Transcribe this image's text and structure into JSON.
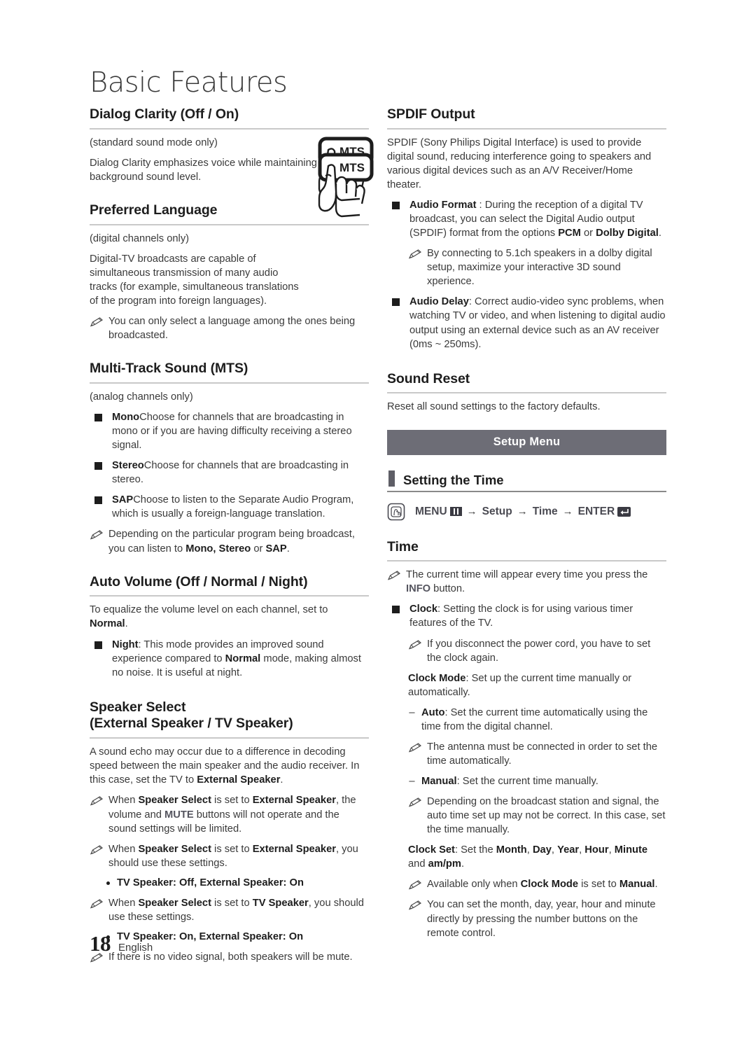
{
  "page": {
    "title": "Basic Features",
    "number": "18",
    "language": "English"
  },
  "left_column": {
    "dialog_clarity": {
      "heading": "Dialog Clarity (Off / On)",
      "note": "(standard sound mode only)",
      "body": "Dialog Clarity emphasizes voice while maintaining the background sound level."
    },
    "preferred_language": {
      "heading": "Preferred Language",
      "note": "(digital channels only)",
      "body": "Digital-TV broadcasts are capable of simultaneous transmission of many audio tracks (for example, simultaneous translations of the program into foreign languages).",
      "tip": "You can only select a language among the ones being broadcasted.",
      "figure_label": "MTS"
    },
    "mts": {
      "heading": "Multi-Track Sound (MTS)",
      "note": "(analog channels only)",
      "items": [
        {
          "term": "Mono",
          "sep": ": ",
          "text": "Choose for channels that are broadcasting in mono or if you are having difficulty receiving a stereo signal."
        },
        {
          "term": "Stereo",
          "sep": ": ",
          "text": "Choose for channels that are broadcasting in stereo."
        },
        {
          "term": "SAP",
          "sep": ": ",
          "text": "Choose to listen to the Separate Audio Program, which is usually a foreign-language translation."
        }
      ],
      "tip_pre": "Depending on the particular program being broadcast, you can listen to ",
      "tip_bold": "Mono, Stereo",
      "tip_mid": " or ",
      "tip_bold2": "SAP",
      "tip_end": ".",
      "figure_label": "MTS"
    },
    "auto_volume": {
      "heading": "Auto Volume (Off / Normal / Night)",
      "intro_pre": "To equalize the volume level on each channel, set to ",
      "intro_bold": "Normal",
      "intro_end": ".",
      "item_term": "Night",
      "item_pre": ": This mode provides an improved sound experience compared to ",
      "item_bold": "Normal",
      "item_end": " mode, making almost no noise. It is useful at night."
    },
    "speaker_select": {
      "heading_line1": "Speaker Select",
      "heading_line2": "(External Speaker / TV Speaker)",
      "body_pre": "A sound echo may occur due to a difference in decoding speed between the main speaker and the audio receiver. In this case, set the TV to ",
      "body_bold": "External Speaker",
      "body_end": ".",
      "tips": [
        {
          "pre": "When ",
          "b1": "Speaker Select",
          "mid": " is set to ",
          "b2": "External Speaker",
          "post": ", the volume and ",
          "accent": "MUTE",
          "tail": " buttons will not operate and the sound settings will be limited."
        },
        {
          "pre": "When ",
          "b1": "Speaker Select",
          "mid": " is set to ",
          "b2": "External Speaker",
          "post": ", you should use these settings.",
          "accent": "",
          "tail": ""
        },
        {
          "pre": "When ",
          "b1": "Speaker Select",
          "mid": " is set to ",
          "b2": "TV Speaker",
          "post": ", you should use these settings.",
          "accent": "",
          "tail": ""
        }
      ],
      "setting1": "TV Speaker: Off, External Speaker: On",
      "setting2": "TV Speaker: On, External Speaker: On",
      "final_tip": "If there is no video signal, both speakers will be mute."
    }
  },
  "right_column": {
    "spdif": {
      "heading": "SPDIF Output",
      "body": "SPDIF (Sony Philips Digital Interface) is used to provide digital sound, reducing interference going to speakers and various digital devices such as an A/V Receiver/Home theater.",
      "audio_format": {
        "term": "Audio Format",
        "pre": " : During the reception of a digital TV broadcast, you can select the Digital Audio output (SPDIF) format from the options ",
        "b1": "PCM",
        "mid": " or ",
        "b2": "Dolby Digital",
        "end": "."
      },
      "audio_format_tip": "By connecting to 5.1ch speakers in a dolby digital setup, maximize your interactive 3D sound xperience.",
      "audio_delay": {
        "term": "Audio Delay",
        "text": ": Correct audio-video sync problems, when watching TV or video, and when listening to digital audio output using an external device such as an AV receiver (0ms ~ 250ms)."
      }
    },
    "sound_reset": {
      "heading": "Sound Reset",
      "body": "Reset all sound settings to the factory defaults."
    },
    "setup_menu_banner": "Setup Menu",
    "setting_the_time": {
      "heading": "Setting the Time",
      "path": {
        "menu": "MENU",
        "menu_icon": "menu-grid-icon",
        "arrow": "→",
        "step2": "Setup",
        "step3": "Time",
        "enter": "ENTER",
        "enter_icon": "enter-return-icon",
        "hand_icon": "hand-press-icon"
      }
    },
    "time": {
      "heading": "Time",
      "tip_info": {
        "pre": "The current time will appear every time you press the ",
        "accent": "INFO",
        "end": " button."
      },
      "clock": {
        "term": "Clock",
        "text": ": Setting the clock is for using various timer features of the TV."
      },
      "clock_tip": "If you disconnect the power cord, you have to set the clock again.",
      "clock_mode": {
        "term": "Clock Mode",
        "text": ": Set up the current time manually or automatically."
      },
      "auto": {
        "term": "Auto",
        "text": ": Set the current time automatically using the time from the digital channel."
      },
      "auto_tip": "The antenna must be connected in order to set the time automatically.",
      "manual": {
        "term": "Manual",
        "text": ": Set the current time manually."
      },
      "manual_tip": "Depending on the broadcast station and signal, the auto time set up may not be correct. In this case, set the time manually.",
      "clock_set": {
        "term": "Clock Set",
        "pre": ": Set the ",
        "fields": [
          "Month",
          "Day",
          "Year",
          "Hour",
          "Minute"
        ],
        "conj": " and ",
        "last": "am/pm",
        "end": "."
      },
      "clock_set_tip": {
        "pre": "Available only when ",
        "b1": "Clock Mode",
        "mid": " is set to ",
        "b2": "Manual",
        "end": "."
      },
      "number_tip": "You can set the month, day, year, hour and minute directly by pressing the number buttons on the remote control."
    }
  },
  "colors": {
    "banner_bg": "#6d6d76",
    "heading_rule": "#c9c9c9",
    "text": "#3a3a3a",
    "bold_text": "#1d1d1d",
    "accent_grey": "#5a5a66"
  }
}
